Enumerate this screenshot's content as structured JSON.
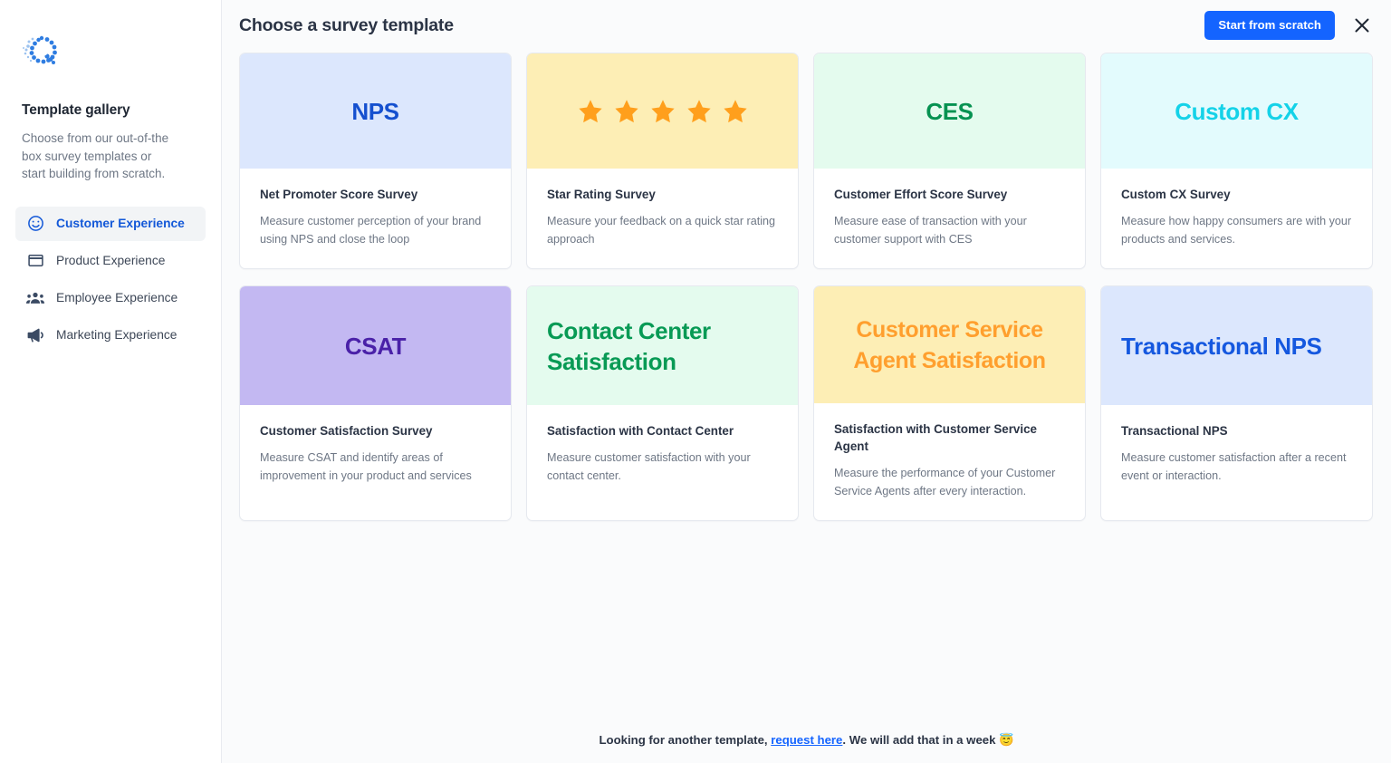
{
  "sidebar": {
    "logo_name": "qualtrics-q-logo",
    "gallery_title": "Template gallery",
    "gallery_subtitle": "Choose from our out-of-the box survey templates or start building from scratch.",
    "nav_items": [
      {
        "label": "Customer Experience",
        "icon": "smiley-face-icon",
        "active": true
      },
      {
        "label": "Product Experience",
        "icon": "browser-window-icon",
        "active": false
      },
      {
        "label": "Employee Experience",
        "icon": "people-group-icon",
        "active": false
      },
      {
        "label": "Marketing Experience",
        "icon": "megaphone-icon",
        "active": false
      }
    ]
  },
  "header": {
    "title": "Choose a survey template",
    "start_from_scratch_label": "Start from scratch",
    "close_icon": "close-x-icon"
  },
  "cards": [
    {
      "banner_text": "NPS",
      "banner_type": "text",
      "banner_align": "center",
      "banner_bg": "#dce7fd",
      "banner_fg": "#1550cf",
      "title": "Net Promoter Score Survey",
      "description": "Measure customer perception of your brand using NPS and close the loop"
    },
    {
      "banner_text": "",
      "banner_type": "stars",
      "banner_align": "center",
      "banner_bg": "#fdeeb5",
      "banner_fg": "#ff9f1c",
      "star_count": 5,
      "title": "Star Rating Survey",
      "description": "Measure your feedback on a quick star rating approach"
    },
    {
      "banner_text": "CES",
      "banner_type": "text",
      "banner_align": "center",
      "banner_bg": "#e4fbee",
      "banner_fg": "#069251",
      "title": "Customer Effort Score Survey",
      "description": "Measure ease of transaction with your customer support with CES"
    },
    {
      "banner_text": "Custom CX",
      "banner_type": "text",
      "banner_align": "center",
      "banner_bg": "#e3fbfd",
      "banner_fg": "#14d2e8",
      "title": "Custom CX Survey",
      "description": "Measure how happy consumers are with your products and services."
    },
    {
      "banner_text": "CSAT",
      "banner_type": "text",
      "banner_align": "center",
      "banner_bg": "#c3b8f2",
      "banner_fg": "#4a21a8",
      "title": "Customer Satisfaction Survey",
      "description": "Measure CSAT and identify areas of improvement in your product and services"
    },
    {
      "banner_text": "Contact Center Satisfaction",
      "banner_type": "text",
      "banner_align": "left",
      "banner_bg": "#e4fbee",
      "banner_fg": "#089a55",
      "title": "Satisfaction with Contact Center",
      "description": "Measure customer satisfaction with your contact center."
    },
    {
      "banner_text": "Customer Service Agent Satisfaction",
      "banner_type": "text",
      "banner_align": "center",
      "banner_bg": "#fdeeb5",
      "banner_fg": "#ff9f2e",
      "title": "Satisfaction with Customer Service Agent",
      "description": "Measure the performance of your Customer Service Agents after every interaction."
    },
    {
      "banner_text": "Transactional NPS",
      "banner_type": "text",
      "banner_align": "left",
      "banner_bg": "#dce7fd",
      "banner_fg": "#1558df",
      "title": "Transactional NPS",
      "description": "Measure customer satisfaction after a recent event or interaction."
    }
  ],
  "footer": {
    "lead_text": "Looking for another template, ",
    "link_text": "request here",
    "tail_text": ". We will add that in a week ",
    "emoji": "😇"
  },
  "colors": {
    "accent_blue": "#1464ff",
    "active_nav_blue": "#1358d8",
    "main_bg": "#fafbfc",
    "text_dark": "#2b3445",
    "text_muted": "#6e7785"
  }
}
